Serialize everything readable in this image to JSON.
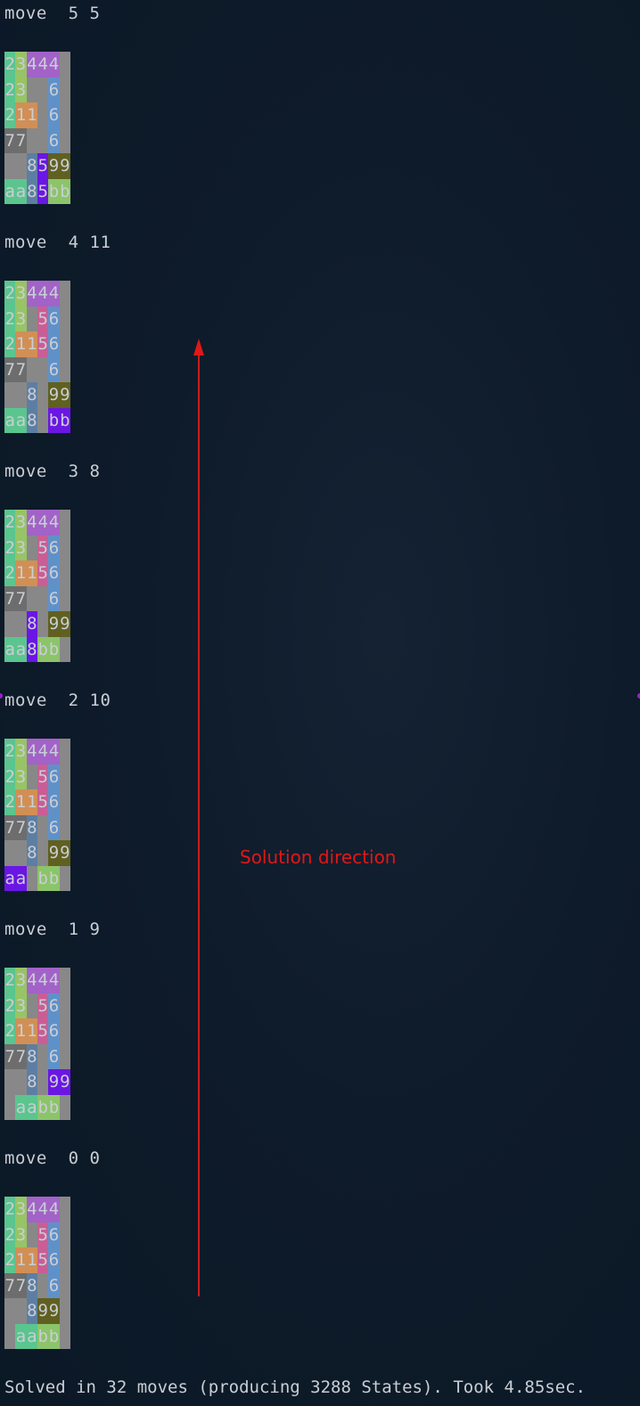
{
  "colors": {
    "background": "#0e1b2a",
    "board_empty": "#888888",
    "text": "#c9ced4",
    "annotation": "#e01818",
    "pieces": {
      "2": "#5bc58e",
      "3": "#97c465",
      "4": "#a262c7",
      "1": "#d18f55",
      "5": "#c95e95",
      "6": "#5f91c9",
      "7": "#6d6d6d",
      "8": "#5d7ea3",
      "9": "#606020",
      "a": "#5bc58e",
      "b": "#8cc46a",
      "hl": "#6a16e4"
    }
  },
  "moves": [
    {
      "label": "move  5 5",
      "rows": [
        [
          [
            "2",
            "2"
          ],
          [
            "3",
            "3"
          ],
          [
            "4",
            "4"
          ],
          [
            "4",
            "4"
          ],
          [
            "4",
            "4"
          ],
          [
            ".",
            "."
          ]
        ],
        [
          [
            "2",
            "2"
          ],
          [
            "3",
            "3"
          ],
          [
            ".",
            "."
          ],
          [
            ".",
            "."
          ],
          [
            "6",
            "6"
          ],
          [
            ".",
            "."
          ]
        ],
        [
          [
            "2",
            "2"
          ],
          [
            "1",
            "1"
          ],
          [
            "1",
            "1"
          ],
          [
            ".",
            "."
          ],
          [
            "6",
            "6"
          ],
          [
            ".",
            "."
          ]
        ],
        [
          [
            "7",
            "7"
          ],
          [
            "7",
            "7"
          ],
          [
            ".",
            "."
          ],
          [
            ".",
            "."
          ],
          [
            "6",
            "6"
          ],
          [
            ".",
            "."
          ]
        ],
        [
          [
            ".",
            "."
          ],
          [
            ".",
            "."
          ],
          [
            "8",
            "8"
          ],
          [
            "5",
            "hl"
          ],
          [
            "9",
            "9"
          ],
          [
            "9",
            "9"
          ]
        ],
        [
          [
            "a",
            "a"
          ],
          [
            "a",
            "a"
          ],
          [
            "8",
            "8"
          ],
          [
            "5",
            "hl"
          ],
          [
            "b",
            "b"
          ],
          [
            "b",
            "b"
          ]
        ]
      ]
    },
    {
      "label": "move  4 11",
      "rows": [
        [
          [
            "2",
            "2"
          ],
          [
            "3",
            "3"
          ],
          [
            "4",
            "4"
          ],
          [
            "4",
            "4"
          ],
          [
            "4",
            "4"
          ],
          [
            ".",
            "."
          ]
        ],
        [
          [
            "2",
            "2"
          ],
          [
            "3",
            "3"
          ],
          [
            ".",
            "."
          ],
          [
            "5",
            "5"
          ],
          [
            "6",
            "6"
          ],
          [
            ".",
            "."
          ]
        ],
        [
          [
            "2",
            "2"
          ],
          [
            "1",
            "1"
          ],
          [
            "1",
            "1"
          ],
          [
            "5",
            "5"
          ],
          [
            "6",
            "6"
          ],
          [
            ".",
            "."
          ]
        ],
        [
          [
            "7",
            "7"
          ],
          [
            "7",
            "7"
          ],
          [
            ".",
            "."
          ],
          [
            ".",
            "."
          ],
          [
            "6",
            "6"
          ],
          [
            ".",
            "."
          ]
        ],
        [
          [
            ".",
            "."
          ],
          [
            ".",
            "."
          ],
          [
            "8",
            "8"
          ],
          [
            ".",
            "."
          ],
          [
            "9",
            "9"
          ],
          [
            "9",
            "9"
          ]
        ],
        [
          [
            "a",
            "a"
          ],
          [
            "a",
            "a"
          ],
          [
            "8",
            "8"
          ],
          [
            ".",
            "."
          ],
          [
            "b",
            "hl"
          ],
          [
            "b",
            "hl"
          ]
        ]
      ]
    },
    {
      "label": "move  3 8",
      "rows": [
        [
          [
            "2",
            "2"
          ],
          [
            "3",
            "3"
          ],
          [
            "4",
            "4"
          ],
          [
            "4",
            "4"
          ],
          [
            "4",
            "4"
          ],
          [
            ".",
            "."
          ]
        ],
        [
          [
            "2",
            "2"
          ],
          [
            "3",
            "3"
          ],
          [
            ".",
            "."
          ],
          [
            "5",
            "5"
          ],
          [
            "6",
            "6"
          ],
          [
            ".",
            "."
          ]
        ],
        [
          [
            "2",
            "2"
          ],
          [
            "1",
            "1"
          ],
          [
            "1",
            "1"
          ],
          [
            "5",
            "5"
          ],
          [
            "6",
            "6"
          ],
          [
            ".",
            "."
          ]
        ],
        [
          [
            "7",
            "7"
          ],
          [
            "7",
            "7"
          ],
          [
            ".",
            "."
          ],
          [
            ".",
            "."
          ],
          [
            "6",
            "6"
          ],
          [
            ".",
            "."
          ]
        ],
        [
          [
            ".",
            "."
          ],
          [
            ".",
            "."
          ],
          [
            "8",
            "hl"
          ],
          [
            ".",
            "."
          ],
          [
            "9",
            "9"
          ],
          [
            "9",
            "9"
          ]
        ],
        [
          [
            "a",
            "a"
          ],
          [
            "a",
            "a"
          ],
          [
            "8",
            "hl"
          ],
          [
            "b",
            "b"
          ],
          [
            "b",
            "b"
          ],
          [
            ".",
            "."
          ]
        ]
      ]
    },
    {
      "label": "move  2 10",
      "rows": [
        [
          [
            "2",
            "2"
          ],
          [
            "3",
            "3"
          ],
          [
            "4",
            "4"
          ],
          [
            "4",
            "4"
          ],
          [
            "4",
            "4"
          ],
          [
            ".",
            "."
          ]
        ],
        [
          [
            "2",
            "2"
          ],
          [
            "3",
            "3"
          ],
          [
            ".",
            "."
          ],
          [
            "5",
            "5"
          ],
          [
            "6",
            "6"
          ],
          [
            ".",
            "."
          ]
        ],
        [
          [
            "2",
            "2"
          ],
          [
            "1",
            "1"
          ],
          [
            "1",
            "1"
          ],
          [
            "5",
            "5"
          ],
          [
            "6",
            "6"
          ],
          [
            ".",
            "."
          ]
        ],
        [
          [
            "7",
            "7"
          ],
          [
            "7",
            "7"
          ],
          [
            "8",
            "8"
          ],
          [
            ".",
            "."
          ],
          [
            "6",
            "6"
          ],
          [
            ".",
            "."
          ]
        ],
        [
          [
            ".",
            "."
          ],
          [
            ".",
            "."
          ],
          [
            "8",
            "8"
          ],
          [
            ".",
            "."
          ],
          [
            "9",
            "9"
          ],
          [
            "9",
            "9"
          ]
        ],
        [
          [
            "a",
            "hl"
          ],
          [
            "a",
            "hl"
          ],
          [
            ".",
            "."
          ],
          [
            "b",
            "b"
          ],
          [
            "b",
            "b"
          ],
          [
            ".",
            "."
          ]
        ]
      ]
    },
    {
      "label": "move  1 9",
      "rows": [
        [
          [
            "2",
            "2"
          ],
          [
            "3",
            "3"
          ],
          [
            "4",
            "4"
          ],
          [
            "4",
            "4"
          ],
          [
            "4",
            "4"
          ],
          [
            ".",
            "."
          ]
        ],
        [
          [
            "2",
            "2"
          ],
          [
            "3",
            "3"
          ],
          [
            ".",
            "."
          ],
          [
            "5",
            "5"
          ],
          [
            "6",
            "6"
          ],
          [
            ".",
            "."
          ]
        ],
        [
          [
            "2",
            "2"
          ],
          [
            "1",
            "1"
          ],
          [
            "1",
            "1"
          ],
          [
            "5",
            "5"
          ],
          [
            "6",
            "6"
          ],
          [
            ".",
            "."
          ]
        ],
        [
          [
            "7",
            "7"
          ],
          [
            "7",
            "7"
          ],
          [
            "8",
            "8"
          ],
          [
            ".",
            "."
          ],
          [
            "6",
            "6"
          ],
          [
            ".",
            "."
          ]
        ],
        [
          [
            ".",
            "."
          ],
          [
            ".",
            "."
          ],
          [
            "8",
            "8"
          ],
          [
            ".",
            "."
          ],
          [
            "9",
            "hl"
          ],
          [
            "9",
            "hl"
          ]
        ],
        [
          [
            ".",
            "."
          ],
          [
            "a",
            "a"
          ],
          [
            "a",
            "a"
          ],
          [
            "b",
            "b"
          ],
          [
            "b",
            "b"
          ],
          [
            ".",
            "."
          ]
        ]
      ]
    },
    {
      "label": "move  0 0",
      "rows": [
        [
          [
            "2",
            "2"
          ],
          [
            "3",
            "3"
          ],
          [
            "4",
            "4"
          ],
          [
            "4",
            "4"
          ],
          [
            "4",
            "4"
          ],
          [
            ".",
            "."
          ]
        ],
        [
          [
            "2",
            "2"
          ],
          [
            "3",
            "3"
          ],
          [
            ".",
            "."
          ],
          [
            "5",
            "5"
          ],
          [
            "6",
            "6"
          ],
          [
            ".",
            "."
          ]
        ],
        [
          [
            "2",
            "2"
          ],
          [
            "1",
            "1"
          ],
          [
            "1",
            "1"
          ],
          [
            "5",
            "5"
          ],
          [
            "6",
            "6"
          ],
          [
            ".",
            "."
          ]
        ],
        [
          [
            "7",
            "7"
          ],
          [
            "7",
            "7"
          ],
          [
            "8",
            "8"
          ],
          [
            ".",
            "."
          ],
          [
            "6",
            "6"
          ],
          [
            ".",
            "."
          ]
        ],
        [
          [
            ".",
            "."
          ],
          [
            ".",
            "."
          ],
          [
            "8",
            "8"
          ],
          [
            "9",
            "9"
          ],
          [
            "9",
            "9"
          ],
          [
            ".",
            "."
          ]
        ],
        [
          [
            ".",
            "."
          ],
          [
            "a",
            "a"
          ],
          [
            "a",
            "a"
          ],
          [
            "b",
            "b"
          ],
          [
            "b",
            "b"
          ],
          [
            ".",
            "."
          ]
        ]
      ]
    }
  ],
  "annotation": {
    "text": "Solution direction"
  },
  "status": {
    "text": "Solved in 32 moves (producing 3288 States). Took 4.85sec."
  }
}
